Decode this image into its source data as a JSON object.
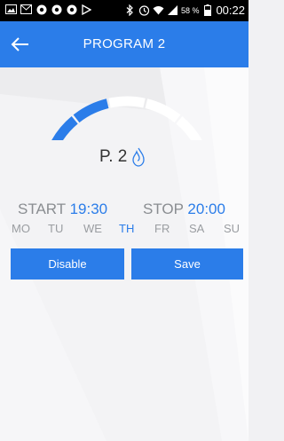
{
  "status_bar": {
    "battery_percent": "58 %",
    "time": "00:22",
    "icons": [
      "image-icon",
      "mail-icon",
      "chrome-icon",
      "chrome-icon",
      "chrome-icon",
      "play-store-icon",
      "bluetooth-icon",
      "alarm-icon",
      "wifi-icon",
      "signal-icon",
      "battery-icon"
    ]
  },
  "app_bar": {
    "title": "PROGRAM 2",
    "back_icon": "arrow-left-icon"
  },
  "gauge": {
    "segments_total": 5,
    "segments_filled": 2,
    "filled_color": "#2b7de9",
    "empty_color": "#ffffff"
  },
  "program": {
    "label": "P. 2",
    "icon": "flame-icon"
  },
  "schedule": {
    "start_label": "START",
    "start_value": "19:30",
    "stop_label": "STOP",
    "stop_value": "20:00"
  },
  "days": [
    {
      "label": "MO",
      "active": false
    },
    {
      "label": "TU",
      "active": false
    },
    {
      "label": "WE",
      "active": false
    },
    {
      "label": "TH",
      "active": true
    },
    {
      "label": "FR",
      "active": false
    },
    {
      "label": "SA",
      "active": false
    },
    {
      "label": "SU",
      "active": false
    }
  ],
  "buttons": {
    "disable": "Disable",
    "save": "Save"
  },
  "colors": {
    "accent": "#2b7de9",
    "text_muted": "#8a8d91"
  }
}
